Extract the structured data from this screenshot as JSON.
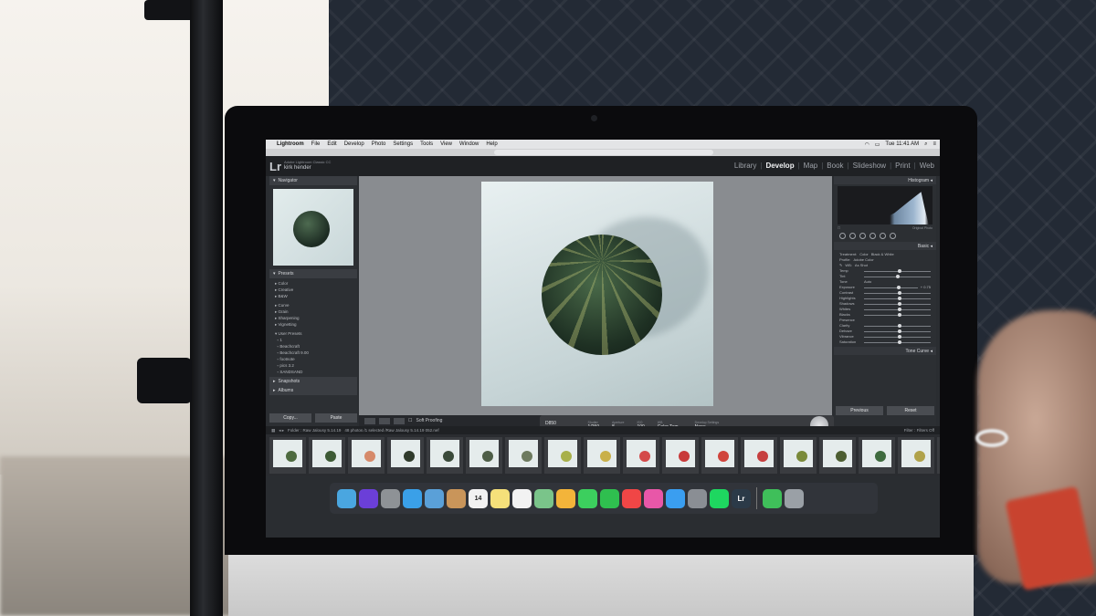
{
  "menubar": {
    "apple": "",
    "app": "Lightroom",
    "items": [
      "File",
      "Edit",
      "Develop",
      "Photo",
      "Settings",
      "Tools",
      "View",
      "Window",
      "Help"
    ],
    "clock": "Tue 11:41 AM"
  },
  "lightroom": {
    "logo": "Lr",
    "catalog_line": "Adobe Lightroom Classic CC",
    "user_name": "kirk hender",
    "modules": [
      "Library",
      "Develop",
      "Map",
      "Book",
      "Slideshow",
      "Print",
      "Web"
    ],
    "active_module": "Develop"
  },
  "left_panel": {
    "navigator_label": "Navigator",
    "presets_label": "Presets",
    "preset_groups": [
      "Color",
      "Creative",
      "B&W",
      "Curve",
      "Grain",
      "Sharpening",
      "Vignetting"
    ],
    "user_presets_label": "User Presets",
    "user_presets": [
      "1",
      "Beachcraft",
      "Beachcraft 9.00",
      "footnote",
      "pics 3.2",
      "SANDSAND"
    ],
    "snapshots_label": "Snapshots",
    "history_label": "Albums",
    "copy_button": "Copy...",
    "paste_button": "Paste"
  },
  "toolbar": {
    "soft_proofing": "Soft Proofing"
  },
  "tether": {
    "camera": "D850",
    "session": "Raw Jalousy 5.14.19",
    "shutter_label": "Shutter",
    "shutter": "1/250",
    "aperture_label": "Aperture",
    "aperture": "8",
    "iso_label": "ISO",
    "iso": "100",
    "wb_label": "WB",
    "wb": "Color Tem...",
    "develop_label": "Develop Settings",
    "develop": "None"
  },
  "right_panel": {
    "histogram_label": "Histogram",
    "original_photo": "Original Photo",
    "basic_label": "Basic",
    "treatment_label": "Treatment:",
    "color_option": "Color",
    "bw_option": "Black & White",
    "profile_label": "Profile:",
    "profile_value": "Adobe Color",
    "wb_label": "WB:",
    "wb_value": "As Shot",
    "tone_label": "Tone",
    "auto_label": "Auto",
    "presence_label": "Presence",
    "sliders": [
      {
        "label": "Temp",
        "pos": 0.5
      },
      {
        "label": "Tint",
        "pos": 0.48
      },
      {
        "label": "Exposure",
        "pos": 0.62
      },
      {
        "label": "Contrast",
        "pos": 0.5
      },
      {
        "label": "Highlights",
        "pos": 0.5
      },
      {
        "label": "Shadows",
        "pos": 0.5
      },
      {
        "label": "Whites",
        "pos": 0.5
      },
      {
        "label": "Blacks",
        "pos": 0.5
      },
      {
        "label": "Clarity",
        "pos": 0.5
      },
      {
        "label": "Dehaze",
        "pos": 0.5
      },
      {
        "label": "Vibrance",
        "pos": 0.5
      },
      {
        "label": "Saturation",
        "pos": 0.5
      }
    ],
    "exposure_value": "+ 0.75",
    "tone_curve_label": "Tone Curve",
    "previous_button": "Previous",
    "reset_button": "Reset"
  },
  "filmstrip": {
    "folder": "Folder : Raw Jalousy 5.14.19",
    "count": "48 photos /1 selected /Raw Jalousy 5.14.19 052.nef",
    "filter_label": "Filter :",
    "filter_value": "Filters Off",
    "frames": [
      {
        "color": "#4d6a3f"
      },
      {
        "color": "#3d5a35"
      },
      {
        "color": "#d68a6a"
      },
      {
        "color": "#2f3a2b"
      },
      {
        "color": "#3a4a3a"
      },
      {
        "color": "#4e5e47"
      },
      {
        "color": "#6d7a5f"
      },
      {
        "color": "#a8b04a"
      },
      {
        "color": "#c9b04a"
      },
      {
        "color": "#d44a4a"
      },
      {
        "color": "#c83a3a"
      },
      {
        "color": "#d0443c"
      },
      {
        "color": "#c63f3f"
      },
      {
        "color": "#7a8a3a"
      },
      {
        "color": "#4d5e32"
      },
      {
        "color": "#3e6a3e"
      },
      {
        "color": "#b0a24a"
      },
      {
        "color": "#2e4a33"
      }
    ]
  },
  "dock": {
    "apps": [
      {
        "name": "finder-icon",
        "color": "#4aa6e0"
      },
      {
        "name": "siri-icon",
        "color": "#6b3fd8"
      },
      {
        "name": "launchpad-icon",
        "color": "#8e9296"
      },
      {
        "name": "safari-icon",
        "color": "#3aa0e8"
      },
      {
        "name": "mail-icon",
        "color": "#5aa0d8"
      },
      {
        "name": "contacts-icon",
        "color": "#c9955a"
      },
      {
        "name": "calendar-icon",
        "color": "#f2f2f2",
        "text": "14"
      },
      {
        "name": "notes-icon",
        "color": "#f5e07a"
      },
      {
        "name": "reminders-icon",
        "color": "#f2f2f2"
      },
      {
        "name": "maps-icon",
        "color": "#7ac48a"
      },
      {
        "name": "photos-icon",
        "color": "#f3b43a"
      },
      {
        "name": "messages-icon",
        "color": "#3ccf5e"
      },
      {
        "name": "facetime-icon",
        "color": "#2fbf4f"
      },
      {
        "name": "news-icon",
        "color": "#f04646"
      },
      {
        "name": "itunes-icon",
        "color": "#e857a8"
      },
      {
        "name": "app-store-icon",
        "color": "#3a9ef0"
      },
      {
        "name": "system-preferences-icon",
        "color": "#8a8e94"
      },
      {
        "name": "spotify-icon",
        "color": "#1ed760"
      },
      {
        "name": "lightroom-icon",
        "color": "#2b3a48",
        "text": "Lr"
      },
      {
        "name": "downloads-icon",
        "color": "#3fbf5a"
      },
      {
        "name": "trash-icon",
        "color": "#9aa0a6"
      }
    ]
  },
  "apple_logo": ""
}
